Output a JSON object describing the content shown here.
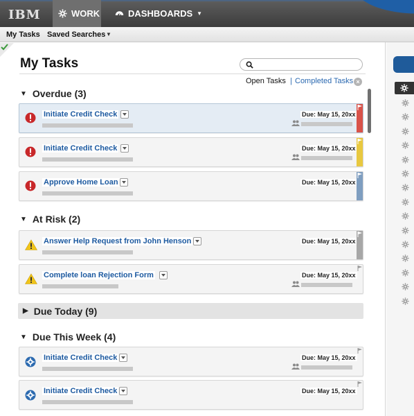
{
  "brand": "IBM",
  "nav": {
    "work_label": "WORK",
    "dashboards_label": "DASHBOARDS"
  },
  "subnav": {
    "my_tasks": "My Tasks",
    "saved_searches": "Saved Searches"
  },
  "page": {
    "title": "My Tasks",
    "search_placeholder": "",
    "tabs": {
      "open": "Open Tasks",
      "separator": "|",
      "completed": "Completed Tasks"
    }
  },
  "sections": {
    "overdue": {
      "label": "Overdue (3)",
      "expanded": true
    },
    "at_risk": {
      "label": "At Risk (2)",
      "expanded": true
    },
    "due_today": {
      "label": "Due Today (9)",
      "expanded": false
    },
    "due_this_week": {
      "label": "Due This Week (4)",
      "expanded": true
    }
  },
  "tasks": [
    {
      "name": "Initiate Credit Check",
      "due": "Due: May 15, 20xx",
      "status": "error",
      "flag_color": "#d9534a",
      "selected": true
    },
    {
      "name": "Initiate Credit Check",
      "due": "Due: May 15, 20xx",
      "status": "error",
      "flag_color": "#e8c840",
      "selected": false
    },
    {
      "name": "Approve Home Loan",
      "due": "Due: May 15, 20xx",
      "status": "error",
      "flag_color": "#7f9ec0",
      "selected": false
    },
    {
      "name": "Answer Help Request from John Henson",
      "due": "Due: May 15, 20xx",
      "status": "warning",
      "flag_color": "#a7a7a7",
      "selected": false
    },
    {
      "name": "Complete loan Rejection Form",
      "due": "Due: May 15, 20xx",
      "status": "warning",
      "flag_color": "#ffffff",
      "selected": false
    },
    {
      "name": "Initiate Credit Check",
      "due": "Due: May 15, 20xx",
      "status": "gear",
      "flag_color": "#ffffff",
      "selected": false
    },
    {
      "name": "Initiate Credit Check",
      "due": "Due: May 15, 20xx",
      "status": "gear",
      "flag_color": "#ffffff",
      "selected": false
    }
  ],
  "colors": {
    "accent_blue": "#1d5aa0",
    "error_red": "#c8282a",
    "warning_yellow": "#f0c419",
    "gear_blue": "#2d6bb0"
  }
}
